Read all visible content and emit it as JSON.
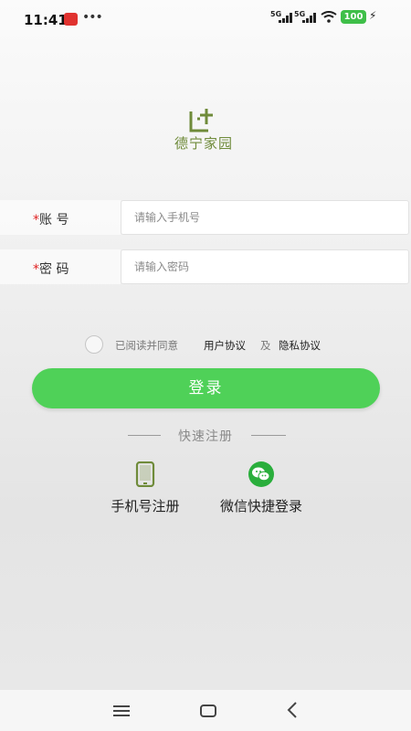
{
  "status_bar": {
    "time": "11:41",
    "more": "•••",
    "net1": "5G",
    "net2": "5G",
    "battery": "100",
    "charging": "⚡"
  },
  "logo": {
    "text": "德宁家园",
    "color": "#6f8b3a"
  },
  "form": {
    "account": {
      "required_mark": "*",
      "label": "账 号",
      "placeholder": "请输入手机号",
      "value": ""
    },
    "password": {
      "required_mark": "*",
      "label": "密 码",
      "placeholder": "请输入密码",
      "value": ""
    }
  },
  "agreement": {
    "prefix": "已阅读并同意",
    "user_agreement": "用户协议",
    "and": "及",
    "privacy_policy": "隐私协议",
    "checked": false
  },
  "login_button": {
    "label": "登录",
    "color": "#4fd158"
  },
  "quick_register": {
    "title": "快速注册",
    "phone": {
      "label": "手机号注册",
      "icon": "phone-icon"
    },
    "wechat": {
      "label": "微信快捷登录",
      "icon": "wechat-icon"
    }
  },
  "nav": {
    "menu_icon": "menu-icon",
    "home_icon": "home-icon",
    "back_icon": "back-icon"
  }
}
